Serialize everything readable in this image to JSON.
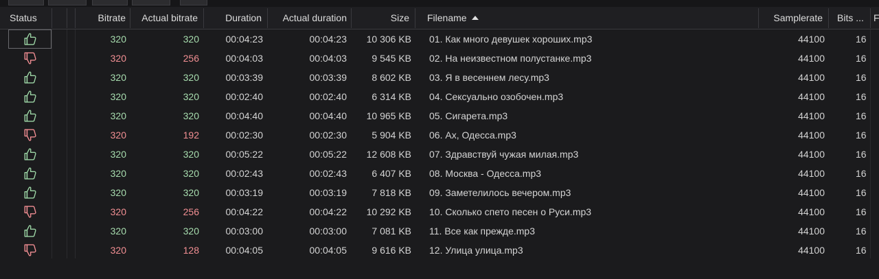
{
  "columns": {
    "status": "Status",
    "bitrate": "Bitrate",
    "actual_bitrate": "Actual bitrate",
    "duration": "Duration",
    "actual_duration": "Actual duration",
    "size": "Size",
    "filename": "Filename",
    "samplerate": "Samplerate",
    "bits": "Bits ...",
    "extra": "F"
  },
  "sort": {
    "column": "filename",
    "direction": "ascending",
    "icon": "sort-ascending-icon"
  },
  "colors": {
    "good": "#a7dcae",
    "bad": "#f28f93",
    "background": "#1b1b1d"
  },
  "rows": [
    {
      "status": "good",
      "icon": "thumbs-up-icon",
      "bitrate": "320",
      "actual_bitrate": "320",
      "duration": "00:04:23",
      "actual_duration": "00:04:23",
      "size": "10 306 KB",
      "filename": "01. Как много девушек хороших.mp3",
      "samplerate": "44100",
      "bits": "16"
    },
    {
      "status": "bad",
      "icon": "thumbs-down-icon",
      "bitrate": "320",
      "actual_bitrate": "256",
      "duration": "00:04:03",
      "actual_duration": "00:04:03",
      "size": "9 545 KB",
      "filename": "02. На неизвестном полустанке.mp3",
      "samplerate": "44100",
      "bits": "16"
    },
    {
      "status": "good",
      "icon": "thumbs-up-icon",
      "bitrate": "320",
      "actual_bitrate": "320",
      "duration": "00:03:39",
      "actual_duration": "00:03:39",
      "size": "8 602 KB",
      "filename": "03. Я в весеннем лесу.mp3",
      "samplerate": "44100",
      "bits": "16"
    },
    {
      "status": "good",
      "icon": "thumbs-up-icon",
      "bitrate": "320",
      "actual_bitrate": "320",
      "duration": "00:02:40",
      "actual_duration": "00:02:40",
      "size": "6 314 KB",
      "filename": "04. Сексуально озобочен.mp3",
      "samplerate": "44100",
      "bits": "16"
    },
    {
      "status": "good",
      "icon": "thumbs-up-icon",
      "bitrate": "320",
      "actual_bitrate": "320",
      "duration": "00:04:40",
      "actual_duration": "00:04:40",
      "size": "10 965 KB",
      "filename": "05. Сигарета.mp3",
      "samplerate": "44100",
      "bits": "16"
    },
    {
      "status": "bad",
      "icon": "thumbs-down-icon",
      "bitrate": "320",
      "actual_bitrate": "192",
      "duration": "00:02:30",
      "actual_duration": "00:02:30",
      "size": "5 904 KB",
      "filename": "06. Ах, Одесса.mp3",
      "samplerate": "44100",
      "bits": "16"
    },
    {
      "status": "good",
      "icon": "thumbs-up-icon",
      "bitrate": "320",
      "actual_bitrate": "320",
      "duration": "00:05:22",
      "actual_duration": "00:05:22",
      "size": "12 608 KB",
      "filename": "07. Здравствуй чужая милая.mp3",
      "samplerate": "44100",
      "bits": "16"
    },
    {
      "status": "good",
      "icon": "thumbs-up-icon",
      "bitrate": "320",
      "actual_bitrate": "320",
      "duration": "00:02:43",
      "actual_duration": "00:02:43",
      "size": "6 407 KB",
      "filename": "08. Москва - Одесса.mp3",
      "samplerate": "44100",
      "bits": "16"
    },
    {
      "status": "good",
      "icon": "thumbs-up-icon",
      "bitrate": "320",
      "actual_bitrate": "320",
      "duration": "00:03:19",
      "actual_duration": "00:03:19",
      "size": "7 818 KB",
      "filename": "09. Заметелилось вечером.mp3",
      "samplerate": "44100",
      "bits": "16"
    },
    {
      "status": "bad",
      "icon": "thumbs-down-icon",
      "bitrate": "320",
      "actual_bitrate": "256",
      "duration": "00:04:22",
      "actual_duration": "00:04:22",
      "size": "10 292 KB",
      "filename": "10. Сколько спето песен о Руси.mp3",
      "samplerate": "44100",
      "bits": "16"
    },
    {
      "status": "good",
      "icon": "thumbs-up-icon",
      "bitrate": "320",
      "actual_bitrate": "320",
      "duration": "00:03:00",
      "actual_duration": "00:03:00",
      "size": "7 081 KB",
      "filename": "11. Все как прежде.mp3",
      "samplerate": "44100",
      "bits": "16"
    },
    {
      "status": "bad",
      "icon": "thumbs-down-icon",
      "bitrate": "320",
      "actual_bitrate": "128",
      "duration": "00:04:05",
      "actual_duration": "00:04:05",
      "size": "9 616 KB",
      "filename": "12. Улица улица.mp3",
      "samplerate": "44100",
      "bits": "16"
    }
  ]
}
